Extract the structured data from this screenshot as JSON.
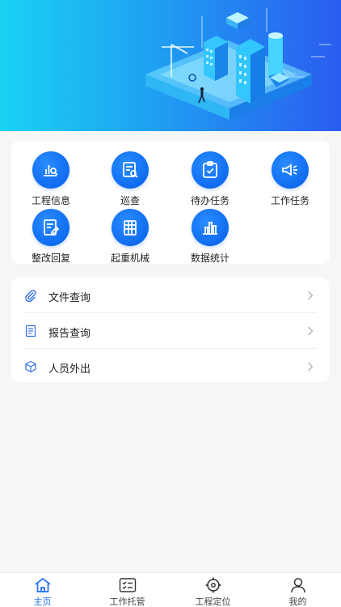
{
  "grid": {
    "items": [
      {
        "label": "工程信息",
        "icon": "chart-search-icon"
      },
      {
        "label": "巡查",
        "icon": "inspection-icon"
      },
      {
        "label": "待办任务",
        "icon": "clipboard-check-icon"
      },
      {
        "label": "工作任务",
        "icon": "megaphone-icon"
      },
      {
        "label": "整改回复",
        "icon": "document-edit-icon"
      },
      {
        "label": "起重机械",
        "icon": "crane-icon"
      },
      {
        "label": "数据统计",
        "icon": "bar-chart-icon"
      }
    ]
  },
  "list": {
    "items": [
      {
        "label": "文件查询",
        "icon": "paperclip-icon"
      },
      {
        "label": "报告查询",
        "icon": "document-icon"
      },
      {
        "label": "人员外出",
        "icon": "cube-icon"
      }
    ]
  },
  "tabbar": {
    "items": [
      {
        "label": "主页",
        "icon": "home-icon",
        "active": true
      },
      {
        "label": "工作托管",
        "icon": "task-list-icon",
        "active": false
      },
      {
        "label": "工程定位",
        "icon": "crosshair-icon",
        "active": false
      },
      {
        "label": "我的",
        "icon": "user-icon",
        "active": false
      }
    ]
  },
  "colors": {
    "accent": "#1f6ff0",
    "banner_start": "#19d2f3",
    "banner_end": "#2a5cf0",
    "background": "#f5f6f8"
  }
}
